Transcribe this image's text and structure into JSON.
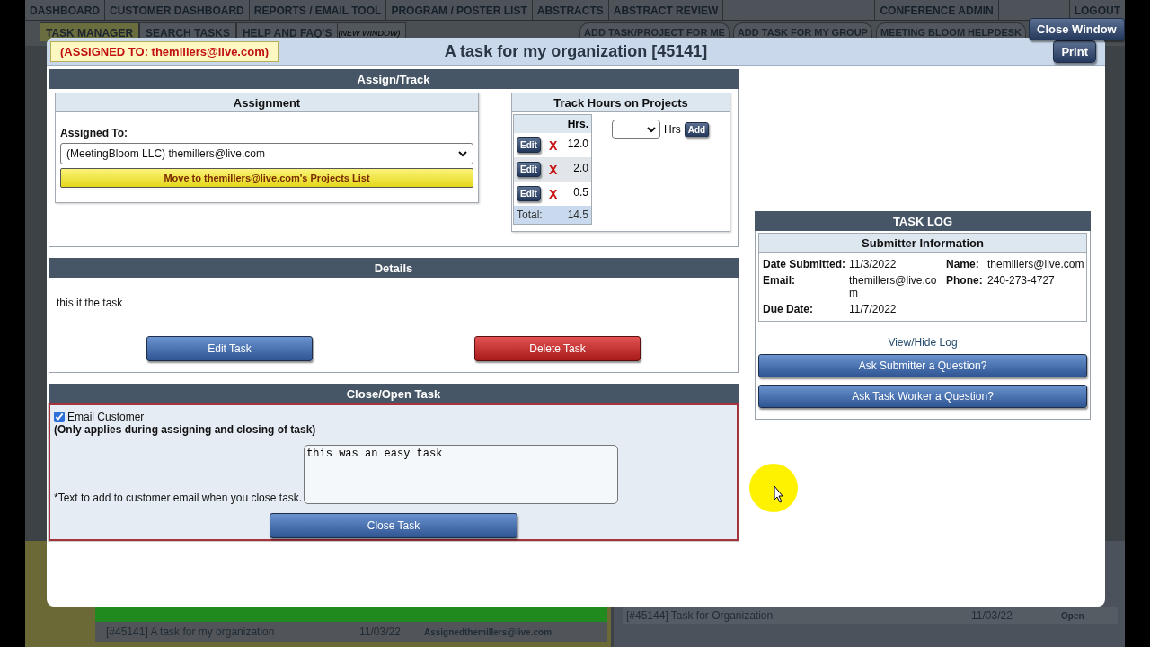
{
  "background": {
    "nav_tabs": [
      "DASHBOARD",
      "CUSTOMER DASHBOARD",
      "REPORTS / EMAIL TOOL",
      "PROGRAM / POSTER LIST",
      "ABSTRACTS",
      "ABSTRACT REVIEW"
    ],
    "nav_right_tabs": [
      "CONFERENCE ADMIN",
      "LOGOUT"
    ],
    "subnav_tabs": [
      {
        "label": "TASK MANAGER",
        "selected": true
      },
      {
        "label": "SEARCH TASKS",
        "selected": false
      },
      {
        "label": "HELP AND FAQ'S",
        "note": "(NEW WINDOW)",
        "selected": false
      }
    ],
    "subnav_right_tabs": [
      "ADD TASK/PROJECT FOR ME",
      "ADD TASK FOR MY GROUP",
      "MEETING BLOOM HELPDESK"
    ],
    "left_rows": [
      {
        "task": "[#45141] A task for my organization",
        "date": "11/03/22",
        "status": "Assignedthemillers@live.com"
      }
    ],
    "right_rows": [
      {
        "task": "[#45144] Task for Organization",
        "date": "11/03/22",
        "status": "Open"
      }
    ]
  },
  "close_window_button": "Close Window",
  "modal": {
    "assigned_badge": "(ASSIGNED TO: themillers@live.com)",
    "title": "A task for my organization [45141]",
    "print_button": "Print",
    "assign_track": {
      "heading": "Assign/Track",
      "assignment": {
        "heading": "Assignment",
        "label": "Assigned To:",
        "select_value": "(MeetingBloom LLC) themillers@live.com",
        "move_button": "Move to themillers@live.com's Projects List"
      },
      "track_hours": {
        "heading": "Track Hours on Projects",
        "column": "Hrs.",
        "entries": [
          {
            "edit": "Edit",
            "delete": "X",
            "hours": "12.0"
          },
          {
            "edit": "Edit",
            "delete": "X",
            "hours": "2.0"
          },
          {
            "edit": "Edit",
            "delete": "X",
            "hours": "0.5"
          }
        ],
        "total_label": "Total:",
        "total": "14.5",
        "unit": "Hrs",
        "add_button": "Add"
      }
    },
    "details": {
      "heading": "Details",
      "text": "this it the task",
      "edit_button": "Edit Task",
      "delete_button": "Delete Task"
    },
    "close_open": {
      "heading": "Close/Open Task",
      "email_customer": {
        "label": "Email Customer",
        "checked": true
      },
      "note": "(Only applies during assigning and closing of task)",
      "textarea_label": "*Text to add to customer email when you close task.",
      "textarea_value": "this was an easy task",
      "close_button": "Close Task"
    },
    "task_log": {
      "heading": "TASK LOG",
      "submitter_heading": "Submitter Information",
      "fields": [
        {
          "label": "Date Submitted:",
          "value": "11/3/2022",
          "label2": "Name:",
          "value2": "themillers@live.com"
        },
        {
          "label": "Email:",
          "value": "themillers@live.com",
          "label2": "Phone:",
          "value2": "240-273-4727"
        },
        {
          "label": "Due Date:",
          "value": "11/7/2022"
        }
      ],
      "view_log_link": "View/Hide Log",
      "buttons": [
        "Ask Submitter a Question?",
        "Ask Task Worker a Question?"
      ]
    }
  }
}
